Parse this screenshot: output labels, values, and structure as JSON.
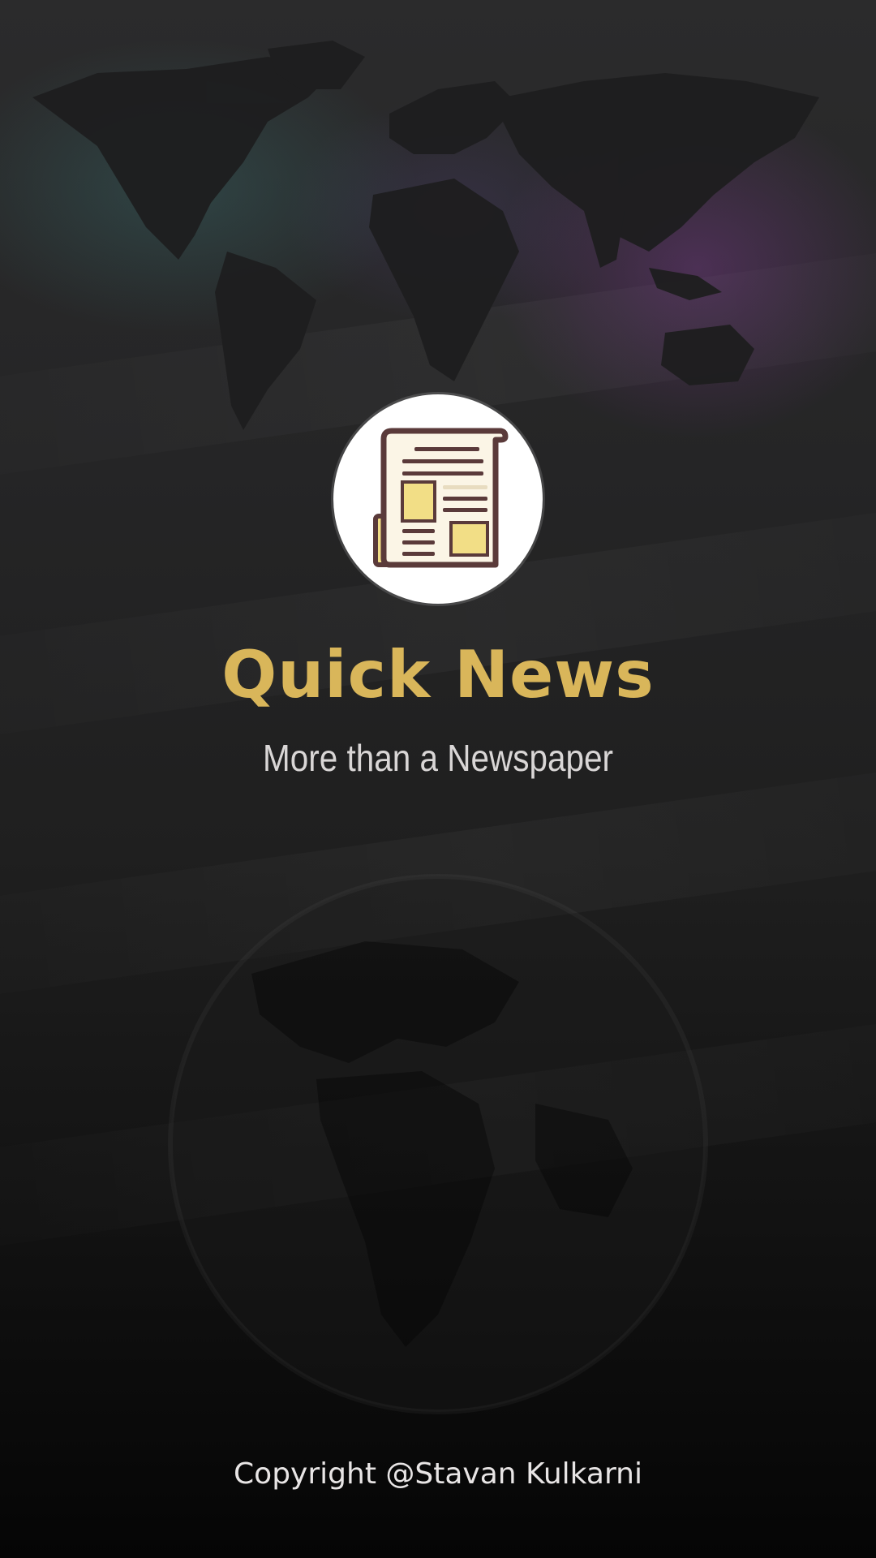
{
  "app": {
    "title": "Quick News",
    "tagline": "More than a Newspaper",
    "copyright": "Copyright @Stavan Kulkarni"
  },
  "logo": {
    "icon": "newspaper-icon"
  },
  "background": {
    "top_image": "world-map",
    "bottom_image": "globe"
  },
  "colors": {
    "title": "#d9b65a",
    "tagline": "#d9d6d6",
    "copyright": "#e8e5e5",
    "logo_background": "#ffffff",
    "newspaper_paper": "#fbf5e6",
    "newspaper_accent": "#f2de86",
    "newspaper_outline": "#5a3a3a"
  }
}
